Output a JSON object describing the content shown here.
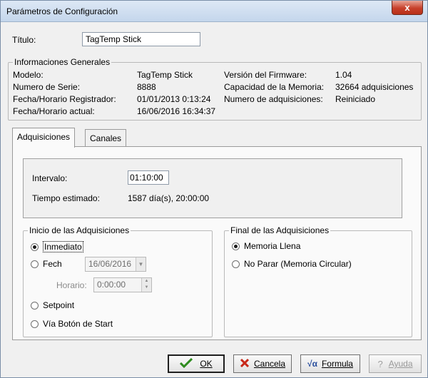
{
  "window": {
    "title": "Parámetros de Configuración",
    "close_label": "x"
  },
  "titulo": {
    "label": "Título:",
    "value": "TagTemp Stick"
  },
  "info": {
    "group_label": "Informaciones Generales",
    "modelo_label": "Modelo:",
    "modelo_value": "TagTemp Stick",
    "serie_label": "Numero de Serie:",
    "serie_value": "8888",
    "fecha_reg_label": "Fecha/Horario Registrador:",
    "fecha_reg_value": "01/01/2013 0:13:24",
    "fecha_act_label": "Fecha/Horario actual:",
    "fecha_act_value": "16/06/2016 16:34:37",
    "firmware_label": "Versión del Firmware:",
    "firmware_value": "1.04",
    "capacidad_label": "Capacidad de la Memoria:",
    "capacidad_value": "32664 adquisiciones",
    "num_adq_label": "Numero de adquisiciones:",
    "num_adq_value": "Reiniciado"
  },
  "tabs": {
    "adquisiciones": "Adquisiciones",
    "canales": "Canales"
  },
  "intervalo": {
    "label": "Intervalo:",
    "value": "01:10:00",
    "tiempo_label": "Tiempo estimado:",
    "tiempo_value": "1587 día(s), 20:00:00"
  },
  "inicio": {
    "group_label": "Inicio de las Adquisiciones",
    "inmediato": "Inmediato",
    "fecha": "Fech",
    "fecha_value": "16/06/2016",
    "horario_label": "Horario:",
    "horario_value": "0:00:00",
    "setpoint": "Setpoint",
    "boton": "Vía Botón de Start"
  },
  "final": {
    "group_label": "Final de las Adquisiciones",
    "memoria_llena": "Memoria Llena",
    "no_parar": "No Parar (Memoria Circular)"
  },
  "buttons": {
    "ok": "OK",
    "cancela": "Cancela",
    "formula": "Formula",
    "ayuda": "Ayuda"
  },
  "colors": {
    "ok_check": "#2e8b1e",
    "cancel_x": "#c8281a",
    "formula_icon": "#2a4f9e"
  }
}
